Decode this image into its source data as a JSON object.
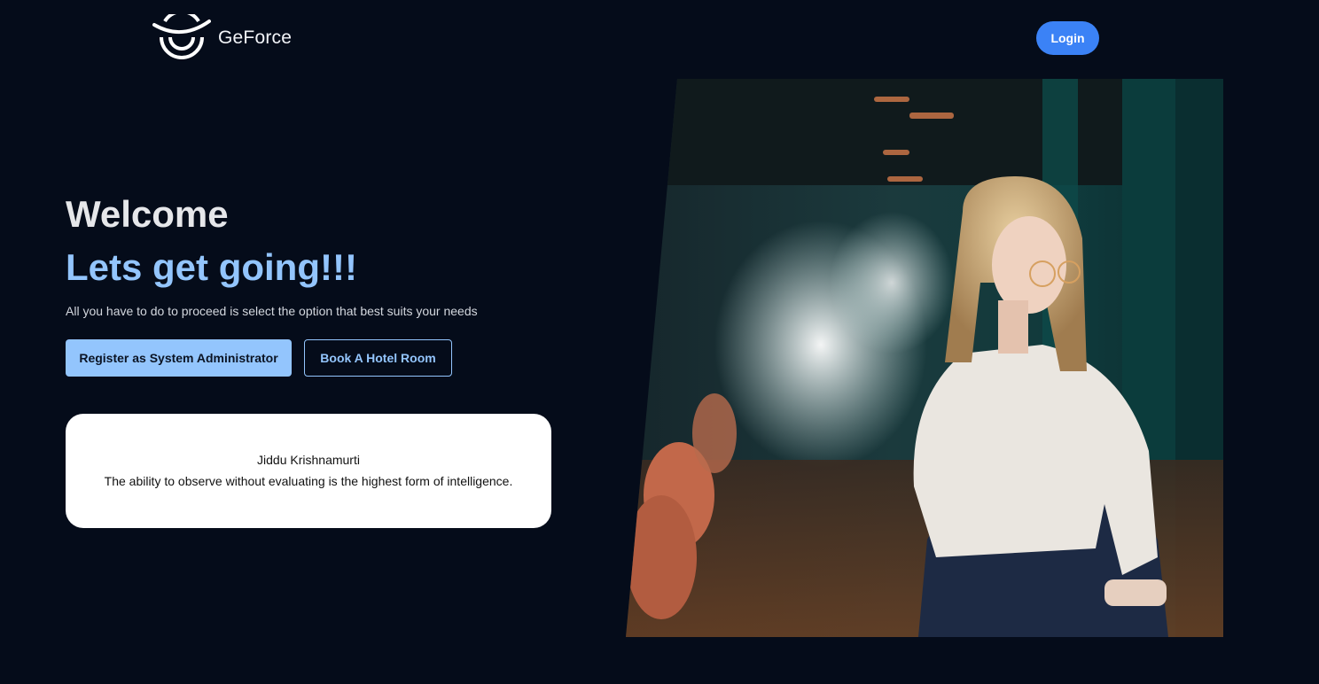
{
  "header": {
    "brand": "GeForce",
    "logo_icon": "geforce-logo-icon",
    "login_label": "Login"
  },
  "hero": {
    "welcome": "Welcome",
    "tagline": "Lets get going!!!",
    "subtext": "All you have to do to proceed is select the option that best suits your needs",
    "primary_button": "Register as System Administrator",
    "secondary_button": "Book A Hotel Room"
  },
  "quote": {
    "author": "Jiddu Krishnamurti",
    "text": "The ability to observe without evaluating is the highest form of intelligence."
  },
  "colors": {
    "background": "#050c1a",
    "accent_blue": "#3b82f6",
    "light_blue": "#93c5fd",
    "card": "#ffffff"
  }
}
